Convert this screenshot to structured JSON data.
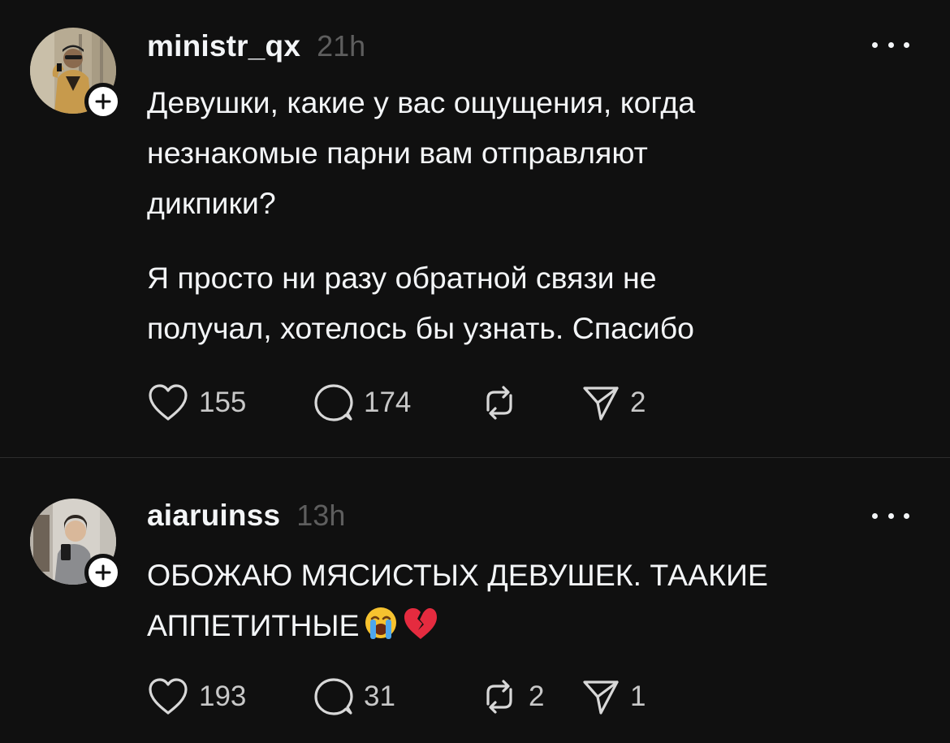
{
  "posts": [
    {
      "username": "ministr_qx",
      "time": "21h",
      "paragraphs": [
        [
          "Девушки, какие у вас ощущения, когда",
          "незнакомые парни вам отправляют",
          "дикпики?"
        ],
        [
          "Я просто ни разу обратной связи не",
          "получал, хотелось бы узнать. Спасибо"
        ]
      ],
      "likes": "155",
      "replies": "174",
      "reposts": "",
      "shares": "2"
    },
    {
      "username": "aiaruinss",
      "time": "13h",
      "paragraphs": [
        [
          "ОБОЖАЮ МЯСИСТЫХ ДЕВУШЕК. ТААКИЕ",
          "АППЕТИТНЫЕ"
        ]
      ],
      "emojis": [
        "loudly-crying-face",
        "broken-heart"
      ],
      "likes": "193",
      "replies": "31",
      "reposts": "2",
      "shares": "1"
    }
  ],
  "icons": {
    "like": "heart-icon",
    "reply": "comment-icon",
    "repost": "repost-icon",
    "share": "send-icon",
    "more": "more-dots-icon",
    "follow": "plus-icon"
  },
  "colors": {
    "background": "#101010",
    "text": "#f3f5f7",
    "muted": "#5e5e5e",
    "divider": "#2d2d2d"
  }
}
